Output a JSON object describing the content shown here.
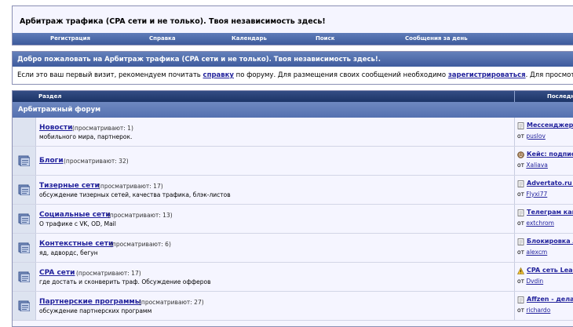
{
  "header": {
    "title": "Арбитраж трафика (CPA сети и не только). Твоя независимость здесь!"
  },
  "nav": {
    "items": [
      {
        "label": "Регистрация"
      },
      {
        "label": "Справка"
      },
      {
        "label": "Календарь"
      },
      {
        "label": "Поиск"
      },
      {
        "label": "Сообщения за день"
      }
    ]
  },
  "welcome": {
    "heading": "Добро пожаловать на Арбитраж трафика (CPA сети и не только). Твоя независимость здесь!.",
    "text_1": "Если это ваш первый визит, рекомендуем почитать ",
    "link_faq": "справку",
    "text_2": " по форуму. Для размещения своих сообщений необходимо ",
    "link_register": "зарегистрироваться",
    "text_3": ". Для просмот"
  },
  "table": {
    "col_section": "Раздел",
    "col_last": "Последн",
    "category": "Арбитражный форум"
  },
  "forums": [
    {
      "name": "Новости",
      "viewers": "(просматривают: 1)",
      "desc": "мобильного мира, партнерок.",
      "last_title": "Мессенджер Т",
      "last_by_prefix": "от ",
      "last_by": "puslov",
      "last_icon": "doc-icon"
    },
    {
      "name": "Блоги",
      "viewers": "(просматривают: 32)",
      "desc": "",
      "last_title": "Кейс: подписк",
      "last_by_prefix": "от ",
      "last_by": "Xaliava",
      "last_icon": "smiley-icon"
    },
    {
      "name": "Тизерные сети",
      "viewers": "(просматривают: 17)",
      "desc": "обсуждение тизерных сетей, качества трафика, блэк-листов",
      "last_title": "Advertato.ru -",
      "last_by_prefix": "от ",
      "last_by": "Flyxi77",
      "last_icon": "doc-icon"
    },
    {
      "name": "Социальные сети",
      "viewers": "(просматривают: 13)",
      "desc": "О трафике с VK, OD, Mail",
      "last_title": "Телеграм кана",
      "last_by_prefix": "от ",
      "last_by": "extchrom",
      "last_icon": "doc-icon"
    },
    {
      "name": "Контекстные сети",
      "viewers": "(просматривают: 6)",
      "desc": "яд, адвордс, бегун",
      "last_title": "Блокировка Ак",
      "last_by_prefix": "от ",
      "last_by": "alexcm",
      "last_icon": "doc-icon"
    },
    {
      "name": "CPA сети",
      "viewers": "(просматривают: 17)",
      "desc": "где достать и сконверить траф. Обсуждение офферов",
      "last_title": "CPA сеть Lead",
      "last_by_prefix": "от ",
      "last_by": "Dvdin",
      "last_icon": "warning-icon"
    },
    {
      "name": "Партнерские программы",
      "viewers": "(просматривают: 27)",
      "desc": "обсуждение партнерских программ",
      "last_title": "Affzen - делай",
      "last_by_prefix": "от ",
      "last_by": "richardo",
      "last_icon": "doc-icon"
    }
  ]
}
